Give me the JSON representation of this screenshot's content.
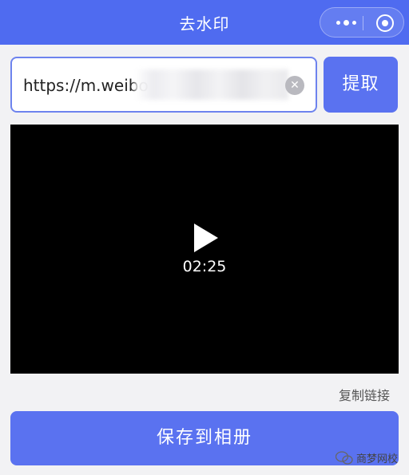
{
  "nav": {
    "title": "去水印"
  },
  "url_input": {
    "value": "https://m.weibo"
  },
  "extract_button": {
    "label": "提取"
  },
  "video": {
    "duration": "02:25"
  },
  "copy_link": {
    "label": "复制链接"
  },
  "save_button": {
    "label": "保存到相册"
  },
  "watermark": {
    "text": "商梦网校"
  },
  "colors": {
    "primary": "#4f6bf0",
    "button": "#5a72f0",
    "background": "#f2f2f4"
  },
  "icons": [
    "more-dots-icon",
    "close-miniprogram-icon",
    "clear-icon",
    "play-icon",
    "wechat-icon"
  ]
}
